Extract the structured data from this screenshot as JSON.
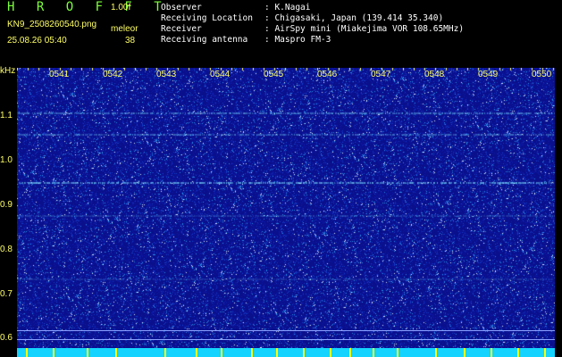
{
  "app": {
    "name": "H R O F F T",
    "version": "1.00f",
    "filename": "KN9_2508260540.png",
    "station": "meleor",
    "datetime": "25.08.26 05:40",
    "count": "38"
  },
  "info": {
    "rows": [
      {
        "label": "Observer",
        "value": ": K.Nagai"
      },
      {
        "label": "Receiving Location",
        "value": ": Chigasaki, Japan (139.414 35.340)"
      },
      {
        "label": "Receiver",
        "value": ": AirSpy mini (Miakejima VOR 108.65MHz)"
      },
      {
        "label": "Receiving antenna",
        "value": ": Maspro FM-3"
      }
    ]
  },
  "axis": {
    "unit": "kHz",
    "time_labels": [
      "0541",
      "0542",
      "0543",
      "0544",
      "0545",
      "0546",
      "0547",
      "0548",
      "0549",
      "0550"
    ],
    "freq_labels": [
      "1.1",
      "1.0",
      "0.9",
      "0.8",
      "0.7",
      "0.6"
    ]
  },
  "colors": {
    "background": "#0a0f8c",
    "accent": "#ffff66",
    "brand": "#7dff3c",
    "bottombar": "#14d4ff"
  }
}
